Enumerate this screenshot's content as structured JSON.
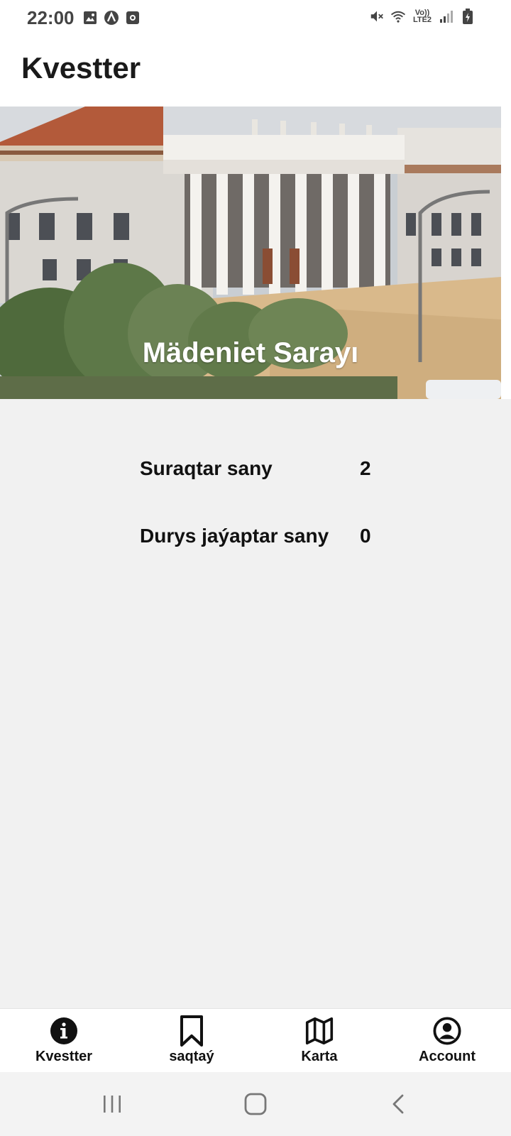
{
  "status_bar": {
    "time": "22:00",
    "left_icons": [
      "gallery-icon",
      "app-a-icon",
      "app-square-icon"
    ],
    "right_icons": [
      "mute-icon",
      "wifi-icon",
      "lte-icon",
      "signal-icon",
      "battery-icon"
    ],
    "lte_line1": "Vo))",
    "lte_line2": "LTE2"
  },
  "app_bar": {
    "title": "Kvestter"
  },
  "hero": {
    "caption": "Mädeniet Sarayı"
  },
  "stats": [
    {
      "label": "Suraqtar sany",
      "value": "2"
    },
    {
      "label": "Durys jaýaptar sany",
      "value": "0"
    }
  ],
  "bottom_nav": {
    "items": [
      {
        "label": "Kvestter",
        "icon": "info-icon"
      },
      {
        "label": "saqtaý",
        "icon": "bookmark-icon"
      },
      {
        "label": "Karta",
        "icon": "map-icon"
      },
      {
        "label": "Account",
        "icon": "account-icon"
      }
    ]
  },
  "system_nav": {
    "buttons": [
      "recent-apps-icon",
      "home-icon",
      "back-icon"
    ]
  },
  "colors": {
    "content_background": "#f1f1f1",
    "text": "#111111",
    "hero_caption": "#ffffff"
  }
}
